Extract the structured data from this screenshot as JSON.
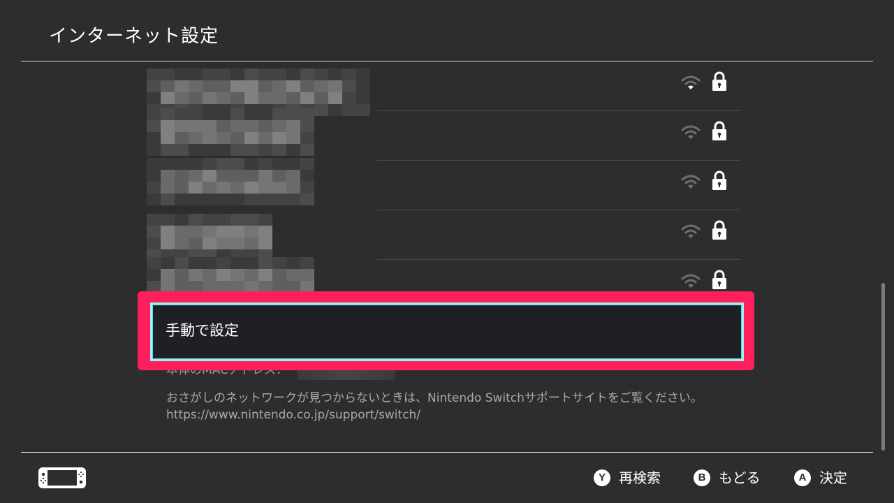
{
  "page": {
    "title": "インターネット設定"
  },
  "networks": [
    {
      "ssid": "",
      "signal": "weak",
      "secured": true
    },
    {
      "ssid": "",
      "signal": "none",
      "secured": true
    },
    {
      "ssid": "",
      "signal": "none",
      "secured": true
    },
    {
      "ssid": "",
      "signal": "none",
      "secured": true
    },
    {
      "ssid": "",
      "signal": "none",
      "secured": true
    }
  ],
  "manual_setup": {
    "label": "手動で設定",
    "selected": true
  },
  "mac": {
    "label": "本体のMACアドレス："
  },
  "info": {
    "line1": "おさがしのネットワークが見つからないときは、Nintendo Switchサポートサイトをご覧ください。",
    "line2": "https://www.nintendo.co.jp/support/switch/"
  },
  "footer": {
    "hints": [
      {
        "button": "Y",
        "label": "再検索"
      },
      {
        "button": "B",
        "label": "もどる"
      },
      {
        "button": "A",
        "label": "決定"
      }
    ]
  },
  "colors": {
    "background": "#2d2d2d",
    "selection_frame": "#ff1f5c",
    "focus_border": "#9ef2f2",
    "button_fill": "#1f2026",
    "muted_text": "#a9a9a9",
    "icon_inactive": "#6f6f6f"
  },
  "icons": {
    "wifi": "wifi-signal-icon",
    "lock": "lock-icon",
    "console": "handheld-console-icon"
  }
}
